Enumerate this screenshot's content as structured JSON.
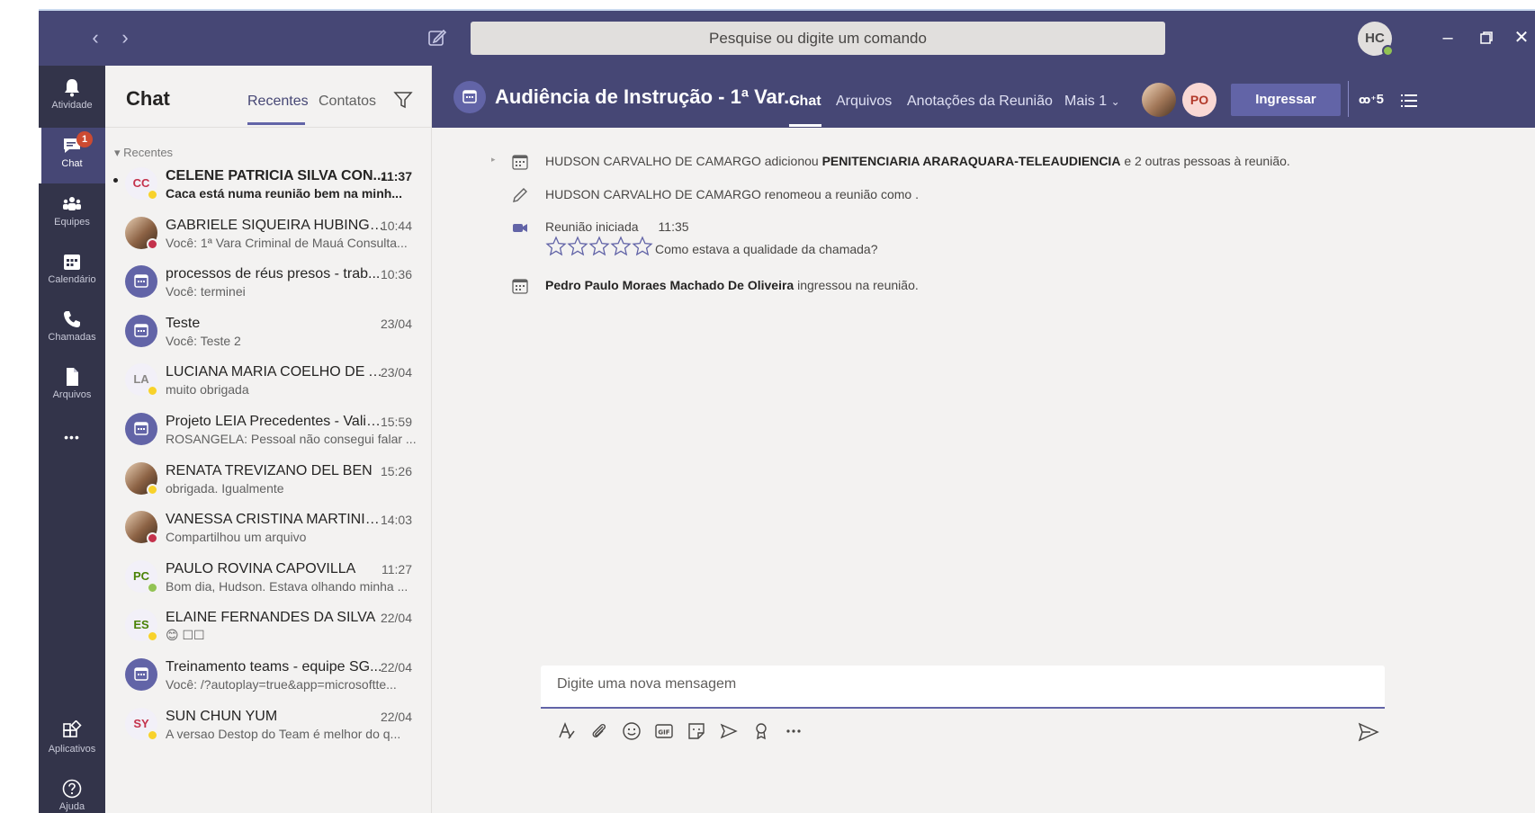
{
  "titlebar": {
    "search_placeholder": "Pesquise ou digite um comando",
    "user_initials": "HC"
  },
  "appbar": {
    "items": [
      {
        "label": "Atividade",
        "icon": "bell-icon"
      },
      {
        "label": "Chat",
        "icon": "chat-icon",
        "badge": "1"
      },
      {
        "label": "Equipes",
        "icon": "teams-icon"
      },
      {
        "label": "Calendário",
        "icon": "calendar-icon"
      },
      {
        "label": "Chamadas",
        "icon": "phone-icon"
      },
      {
        "label": "Arquivos",
        "icon": "file-icon"
      },
      {
        "label": "Aplicativos",
        "icon": "apps-icon"
      },
      {
        "label": "Ajuda",
        "icon": "help-icon"
      }
    ],
    "more": "•••"
  },
  "list": {
    "title": "Chat",
    "tabs": [
      "Recentes",
      "Contatos"
    ],
    "section": "Recentes",
    "items": [
      {
        "name": "CELENE PATRICIA SILVA CON...",
        "time": "11:37",
        "preview": "Caca está numa reunião bem na minh...",
        "initials": "CC",
        "avatar": "initials",
        "initials_color": "#c4314b",
        "status": "#f8d22a",
        "unread": true
      },
      {
        "name": "GABRIELE SIQUEIRA HUBINGER",
        "time": "10:44",
        "preview": "Você: 1ª Vara Criminal de Mauá Consulta...",
        "initials": "",
        "avatar": "photo",
        "status": "#c4314b",
        "unread": false
      },
      {
        "name": "processos de réus presos - trab...",
        "time": "10:36",
        "preview": "Você: terminei",
        "initials": "",
        "avatar": "meeting",
        "status": "",
        "unread": false
      },
      {
        "name": "Teste",
        "time": "23/04",
        "preview": "Você: Teste 2",
        "initials": "",
        "avatar": "meeting",
        "status": "",
        "unread": false
      },
      {
        "name": "LUCIANA MARIA COELHO DE A...",
        "time": "23/04",
        "preview": "muito obrigada",
        "initials": "LA",
        "avatar": "initials",
        "initials_color": "#8a8886",
        "status": "#f8d22a",
        "unread": false
      },
      {
        "name": "Projeto LEIA Precedentes - Valid...",
        "time": "15:59",
        "preview": "ROSANGELA: Pessoal não consegui falar ...",
        "initials": "",
        "avatar": "meeting",
        "status": "",
        "unread": false
      },
      {
        "name": "RENATA TREVIZANO DEL BEN",
        "time": "15:26",
        "preview": "obrigada. Igualmente",
        "initials": "",
        "avatar": "photo",
        "status": "#f8d22a",
        "unread": false
      },
      {
        "name": "VANESSA CRISTINA MARTINIA...",
        "time": "14:03",
        "preview": "Compartilhou um arquivo",
        "initials": "",
        "avatar": "photo",
        "status": "#c4314b",
        "unread": false
      },
      {
        "name": "PAULO ROVINA CAPOVILLA",
        "time": "11:27",
        "preview": "Bom dia, Hudson. Estava olhando minha ...",
        "initials": "PC",
        "avatar": "initials",
        "initials_color": "#498205",
        "status": "#92c353",
        "unread": false
      },
      {
        "name": "ELAINE FERNANDES DA SILVA",
        "time": "22/04",
        "preview": "😊 ☐☐",
        "initials": "ES",
        "avatar": "initials",
        "initials_color": "#498205",
        "status": "#f8d22a",
        "unread": false
      },
      {
        "name": "Treinamento teams - equipe SG...",
        "time": "22/04",
        "preview": "Você: /?autoplay=true&app=microsoftte...",
        "initials": "",
        "avatar": "meeting",
        "status": "",
        "unread": false
      },
      {
        "name": "SUN CHUN YUM",
        "time": "22/04",
        "preview": "A versao Destop do Team é melhor do q...",
        "initials": "SY",
        "avatar": "initials",
        "initials_color": "#c4314b",
        "status": "#f8d22a",
        "unread": false
      }
    ]
  },
  "main": {
    "title": "Audiência de Instrução - 1ª Var...",
    "tabs": [
      "Chat",
      "Arquivos",
      "Anotações da Reunião",
      "Mais 1"
    ],
    "participant_initials": "PO",
    "join_label": "Ingressar",
    "participants_count": "5"
  },
  "conversation": {
    "e1": {
      "actor": "HUDSON CARVALHO DE CAMARGO",
      "mid": " adicionou ",
      "target": "PENITENCIARIA ARARAQUARA-TELEAUDIENCIA",
      "tail": " e 2 outras pessoas à reunião."
    },
    "e2": {
      "actor": "HUDSON CARVALHO DE CAMARGO",
      "tail": " renomeou a reunião como ."
    },
    "e3": {
      "label": "Reunião iniciada",
      "time": "11:35",
      "rating_question": "Como estava a qualidade da chamada?",
      "stars": 5
    },
    "e4": {
      "actor": "Pedro Paulo Moraes Machado De Oliveira",
      "tail": " ingressou na reunião."
    }
  },
  "compose": {
    "placeholder": "Digite uma nova mensagem"
  },
  "colors": {
    "brand": "#464775",
    "accent": "#6264a7",
    "appbar": "#33344a"
  }
}
